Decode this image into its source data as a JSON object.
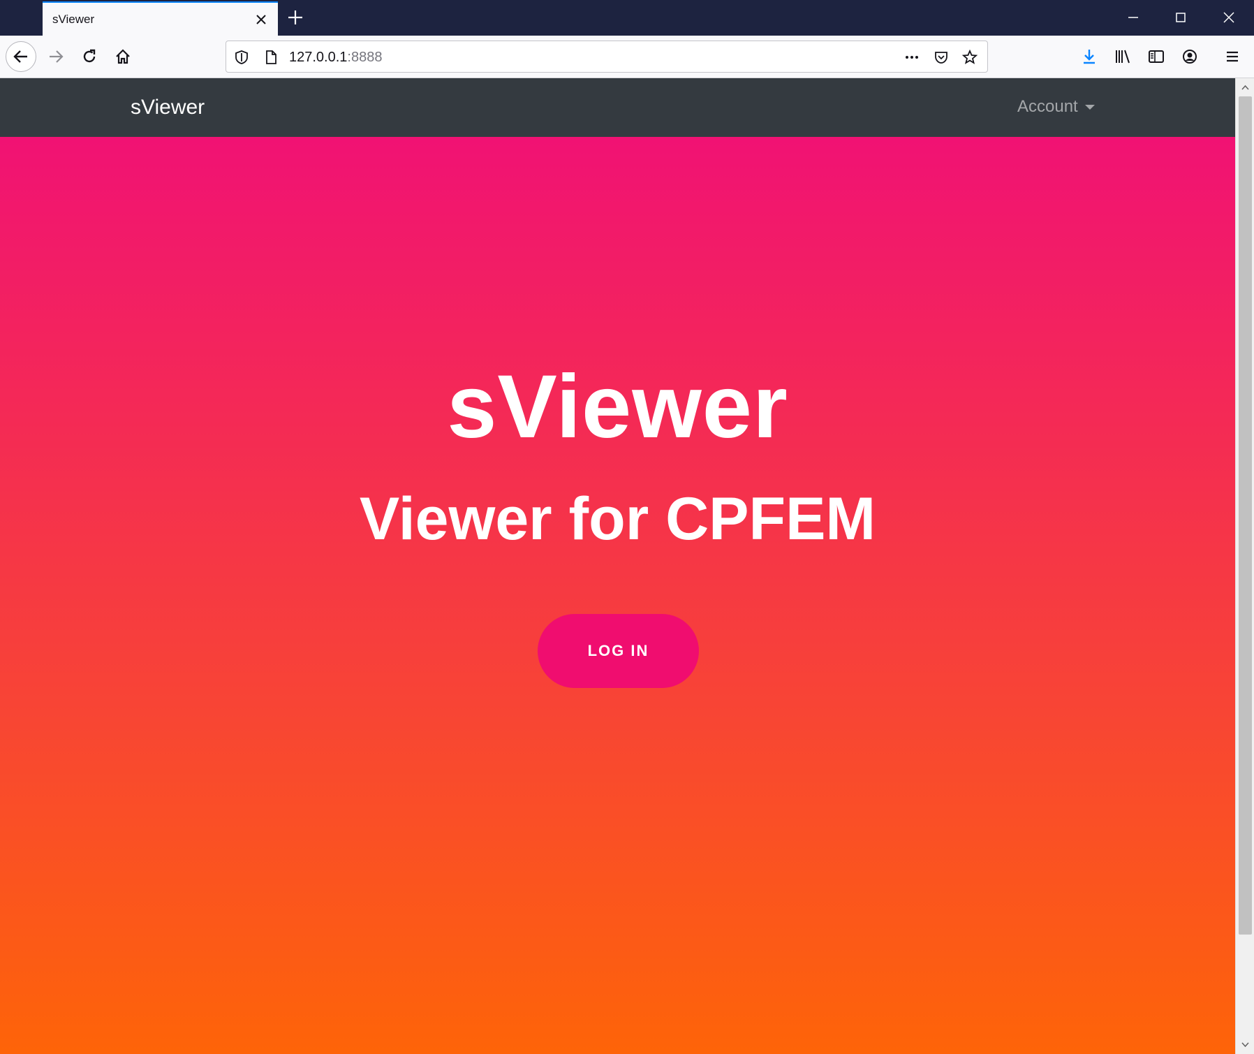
{
  "browser": {
    "tab_title": "sViewer",
    "url_host": "127.0.0.1",
    "url_port": ":8888"
  },
  "navbar": {
    "brand": "sViewer",
    "account_label": "Account"
  },
  "hero": {
    "title": "sViewer",
    "subtitle": "Viewer for CPFEM",
    "login_label": "LOG IN"
  },
  "colors": {
    "gradient_top": "#f00d7a",
    "gradient_bottom": "#fe6408",
    "navbar_bg": "#343a40",
    "button_bg": "#f00d6f",
    "download_accent": "#0a84ff"
  },
  "icons": {
    "tab_close": "close-icon",
    "new_tab": "plus-icon",
    "back": "arrow-left-icon",
    "forward": "arrow-right-icon",
    "reload": "reload-icon",
    "home": "home-icon",
    "tracking": "shield-icon",
    "page": "page-icon",
    "more": "more-icon",
    "pocket": "pocket-icon",
    "bookmark": "star-icon",
    "downloads": "download-icon",
    "library": "library-icon",
    "sidebar": "sidebar-icon",
    "account": "account-icon",
    "menu": "hamburger-icon"
  }
}
